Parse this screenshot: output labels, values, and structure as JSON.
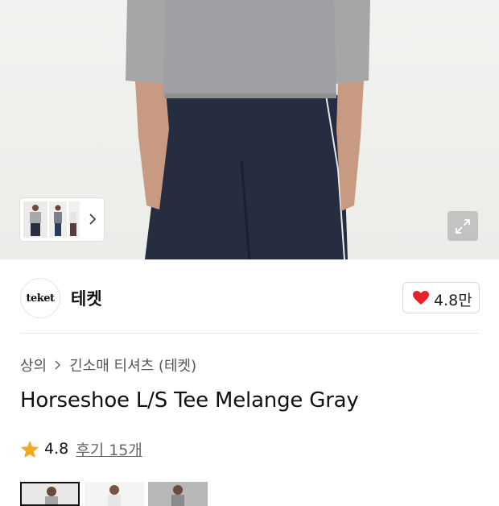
{
  "brand": {
    "logo_text": "teket",
    "name": "테켓",
    "like_count": "4.8만"
  },
  "breadcrumb": {
    "category": "상의",
    "subcategory": "긴소매 티셔츠 (테켓)"
  },
  "product": {
    "title": "Horseshoe L/S Tee Melange Gray",
    "rating": "4.8",
    "review_link": "후기 15개"
  },
  "icons": {
    "like": "heart-icon",
    "rating": "star-icon",
    "expand": "expand-icon",
    "next": "chevron-right-icon"
  },
  "colors": {
    "heart": "#e8202a",
    "star": "#f5a623",
    "expand_bg": "#a0a0a0"
  }
}
